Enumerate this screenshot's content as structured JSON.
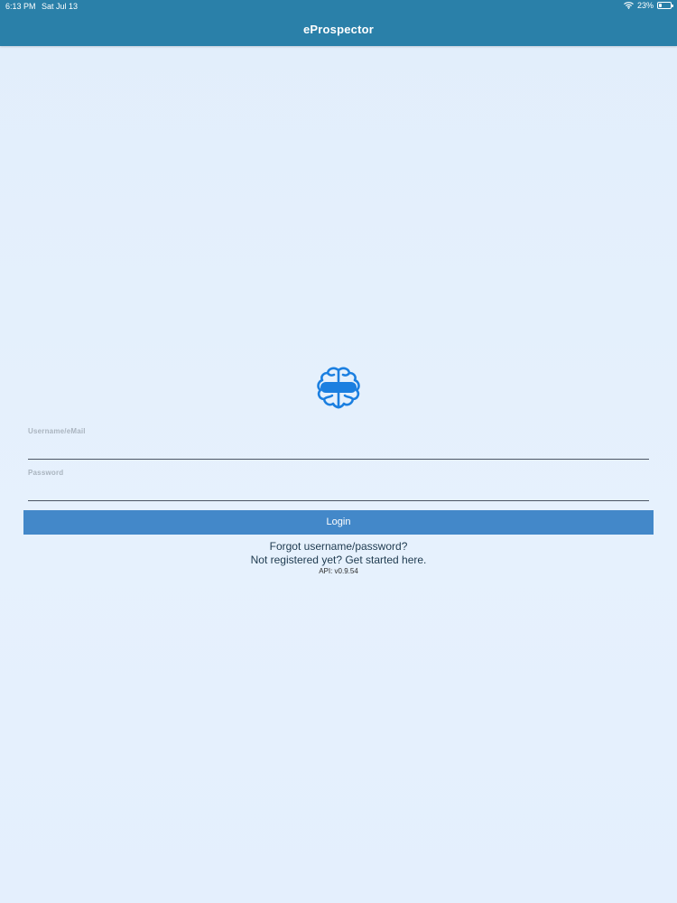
{
  "status_bar": {
    "time": "6:13 PM",
    "date": "Sat Jul 13",
    "battery": "23%",
    "battery_level": 0.23,
    "icons": [
      "wifi-icon",
      "battery-icon"
    ]
  },
  "header": {
    "title": "eProspector",
    "background_color": "#2a80a9"
  },
  "logo": {
    "icon": "brain-icon",
    "color": "#1b7fe0"
  },
  "form": {
    "username_label": "Username/eMail",
    "username_value": "",
    "password_label": "Password",
    "password_value": "",
    "login_label": "Login",
    "login_color": "#4388c9"
  },
  "links": {
    "forgot": "Forgot username/password?",
    "register": "Not registered yet? Get started here."
  },
  "footer": {
    "api_version": "API: v0.9.54"
  }
}
